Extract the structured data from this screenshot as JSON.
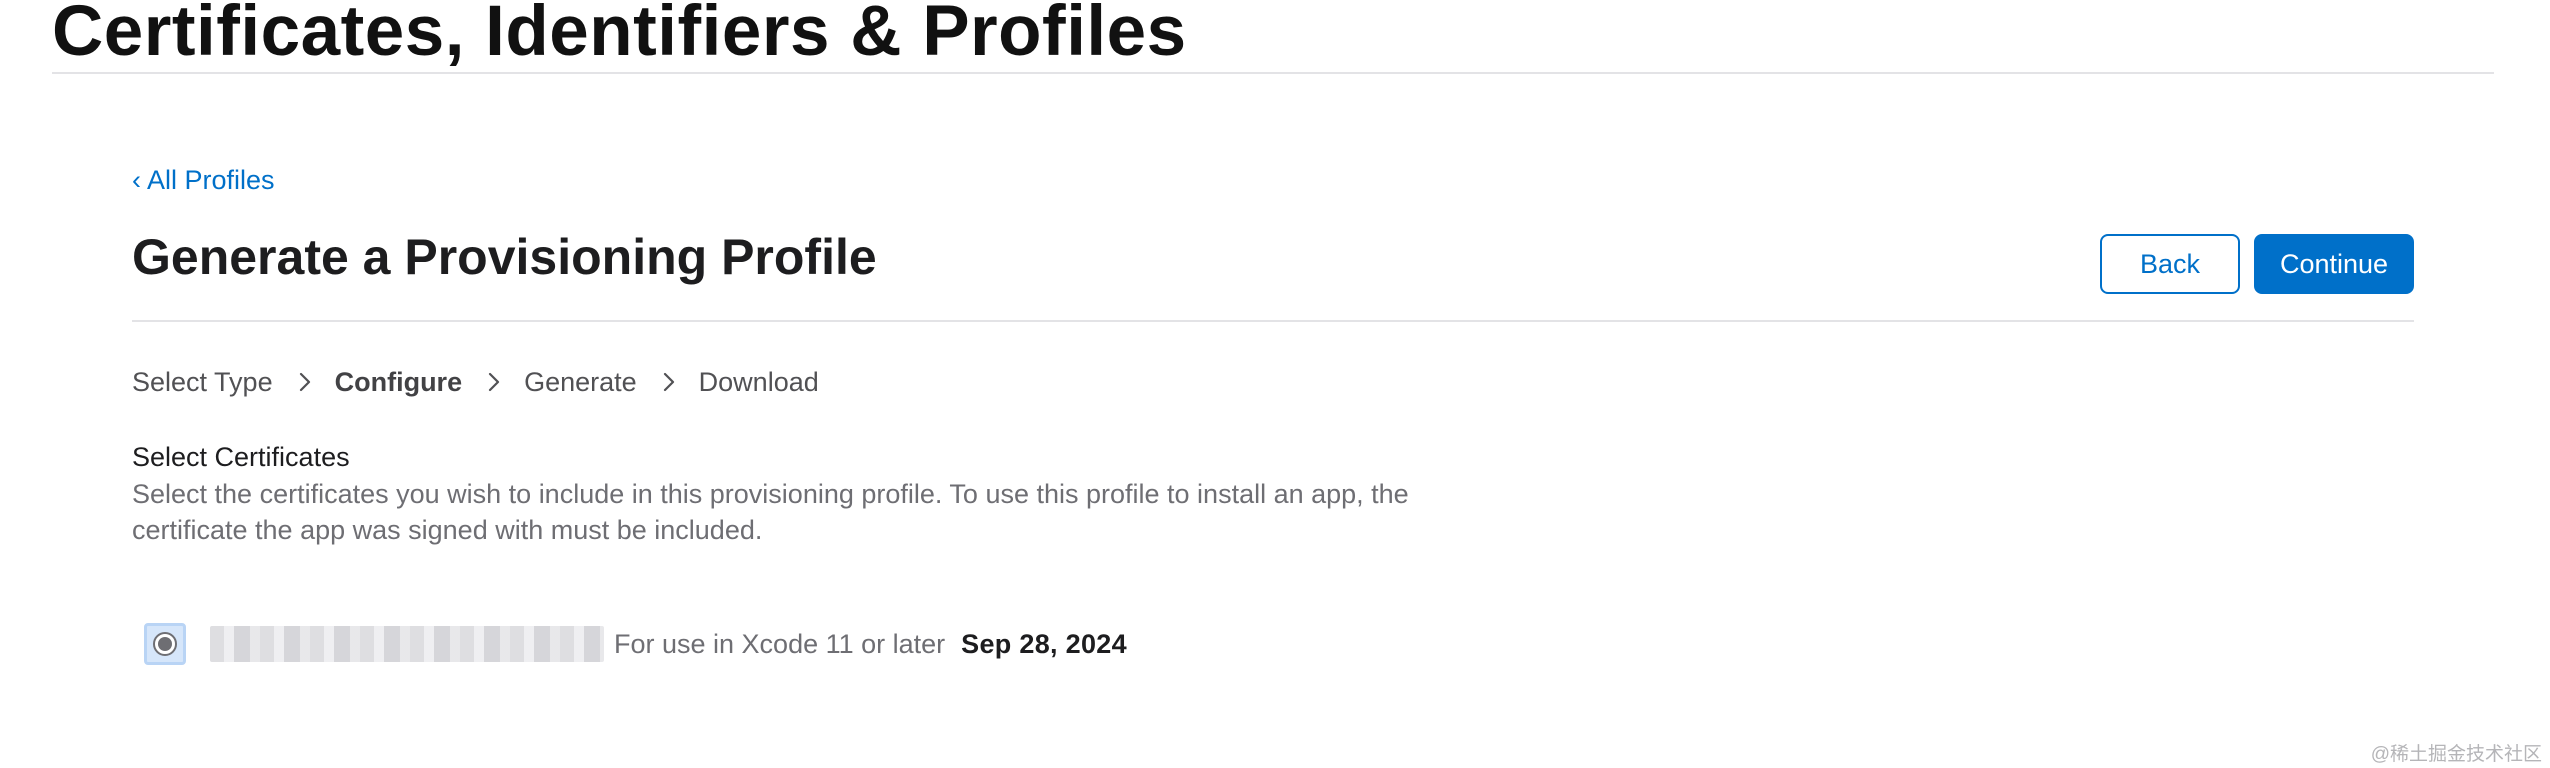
{
  "header": {
    "site_title": "Certificates, Identifiers & Profiles"
  },
  "nav": {
    "back_link_label": "All Profiles",
    "back_link_icon": "chevron-left-icon"
  },
  "page": {
    "title": "Generate a Provisioning Profile",
    "back_button_label": "Back",
    "continue_button_label": "Continue"
  },
  "steps": [
    {
      "label": "Select Type",
      "active": false
    },
    {
      "label": "Configure",
      "active": true
    },
    {
      "label": "Generate",
      "active": false
    },
    {
      "label": "Download",
      "active": false
    }
  ],
  "section": {
    "title": "Select Certificates",
    "description": "Select the certificates you wish to include in this provisioning profile. To use this profile to install an app, the certificate the app was signed with must be included."
  },
  "certificates": [
    {
      "name_redacted": true,
      "usage": "For use in Xcode 11 or later",
      "expiry": "Sep 28, 2024",
      "selected": true
    }
  ],
  "watermark": "@稀土掘金技术社区",
  "colors": {
    "accent": "#0070c9",
    "text_primary": "#1d1d1f",
    "text_secondary": "#6e6e73",
    "divider": "#e3e3e6"
  }
}
